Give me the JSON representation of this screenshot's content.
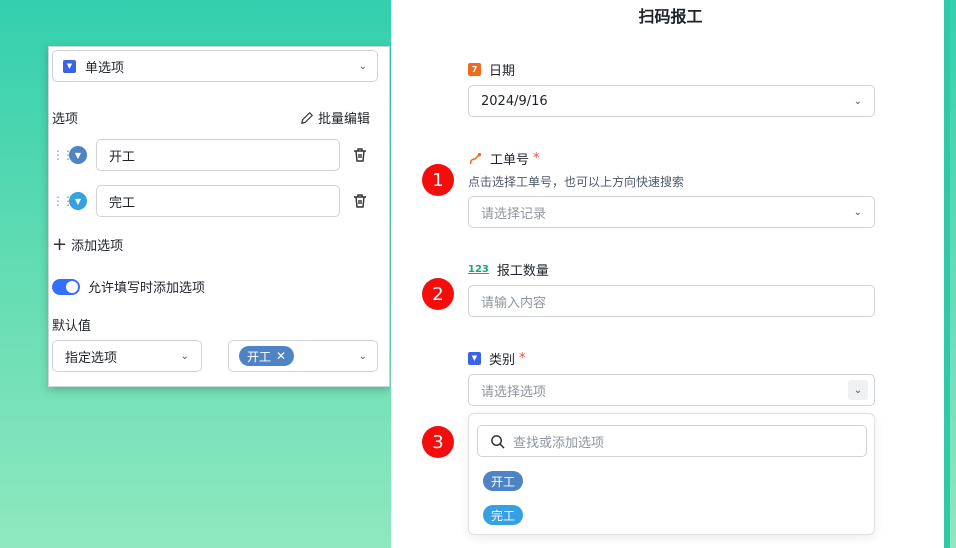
{
  "colors": {
    "open": "#4f84c4",
    "done": "#37a0e3",
    "accent": "#3370ff",
    "badge": "#f40d0d"
  },
  "panel": {
    "type_select": {
      "icon": "dropdown-type-icon",
      "label": "单选项"
    },
    "options_title": "选项",
    "batch_edit": "批量编辑",
    "options": [
      {
        "label": "开工"
      },
      {
        "label": "完工"
      }
    ],
    "add_option": "添加选项",
    "allow_add_toggle": {
      "label": "允许填写时添加选项",
      "on": true
    },
    "default_title": "默认值",
    "default_mode": "指定选项",
    "default_value_tag": "开工"
  },
  "form": {
    "title": "扫码报工",
    "date": {
      "label": "日期",
      "value": "2024/9/16"
    },
    "work_order": {
      "label": "工单号",
      "required_mark": "*",
      "hint": "点击选择工单号，也可以上方向快速搜索",
      "placeholder": "请选择记录"
    },
    "quantity": {
      "label": "报工数量",
      "icon_text": "123",
      "placeholder": "请输入内容"
    },
    "category": {
      "label": "类别",
      "required_mark": "*",
      "placeholder": "请选择选项"
    },
    "dropdown": {
      "search_placeholder": "查找或添加选项",
      "options": [
        {
          "label": "开工"
        },
        {
          "label": "完工"
        }
      ]
    }
  },
  "badges": [
    "1",
    "2",
    "3"
  ]
}
